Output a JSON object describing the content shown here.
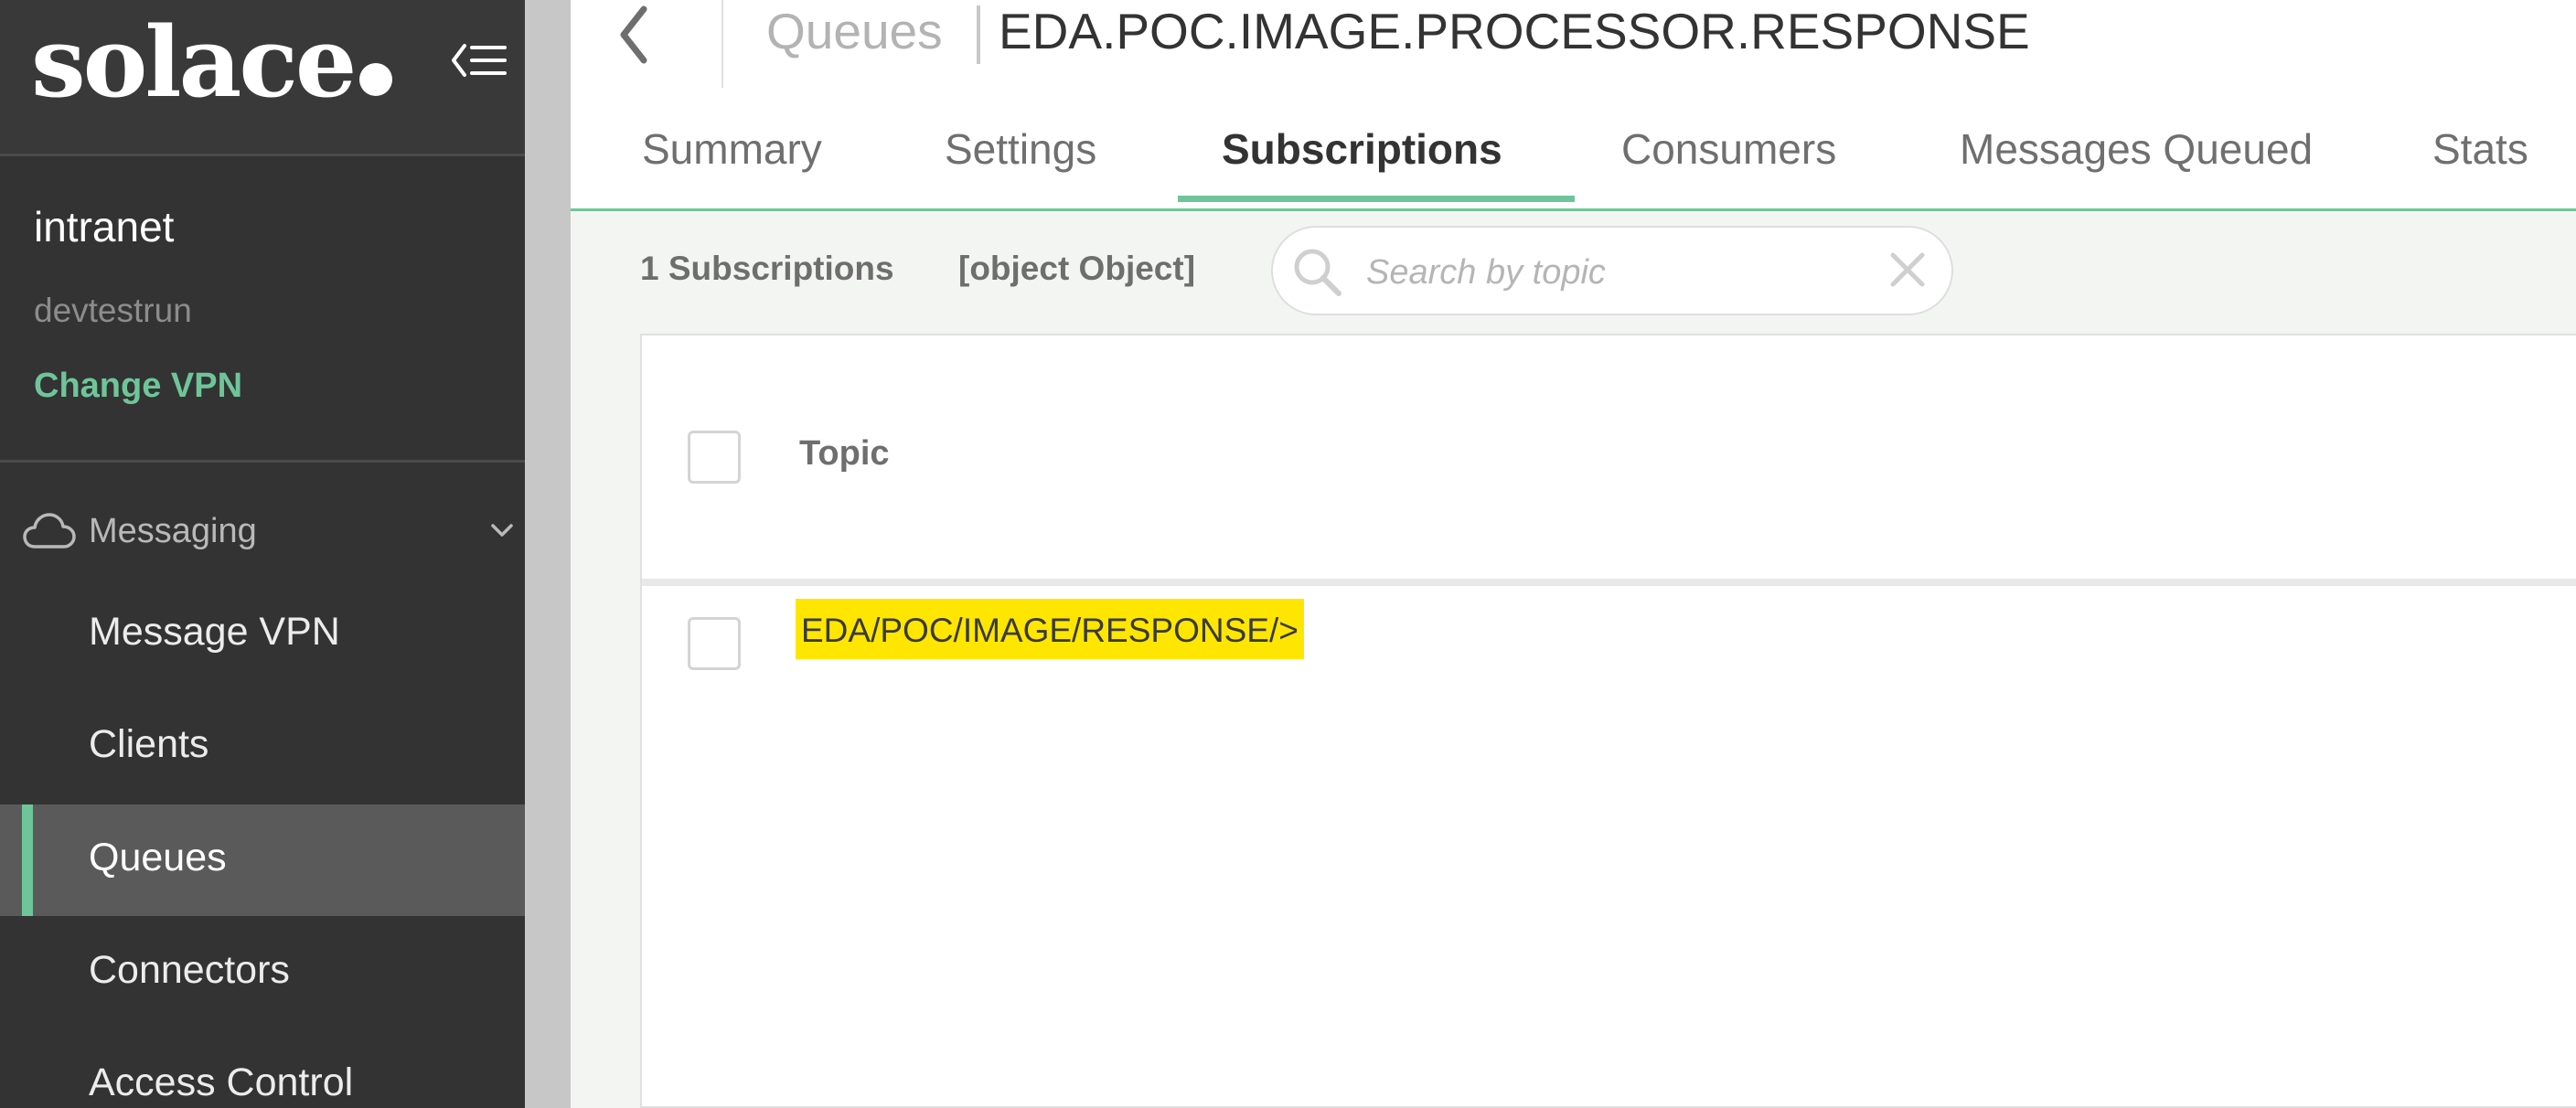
{
  "brand": {
    "logo_text": "solace"
  },
  "sidebar": {
    "vpn_name": "intranet",
    "vpn_sub": "devtestrun",
    "change_vpn_label": "Change VPN",
    "section_label": "Messaging",
    "items": [
      {
        "label": "Message VPN",
        "active": false
      },
      {
        "label": "Clients",
        "active": false
      },
      {
        "label": "Queues",
        "active": true
      },
      {
        "label": "Connectors",
        "active": false
      },
      {
        "label": "Access Control",
        "active": false
      }
    ]
  },
  "header": {
    "breadcrumb": "Queues",
    "title": "EDA.POC.IMAGE.PROCESSOR.RESPONSE"
  },
  "tabs": [
    {
      "label": "Summary",
      "active": false
    },
    {
      "label": "Settings",
      "active": false
    },
    {
      "label": "Subscriptions",
      "active": true
    },
    {
      "label": "Consumers",
      "active": false
    },
    {
      "label": "Messages Queued",
      "active": false
    },
    {
      "label": "Stats",
      "active": false
    }
  ],
  "subscriptions": {
    "count_label": "1 Subscriptions",
    "object_label": "[object Object]",
    "search_placeholder": "Search by topic",
    "column_topic": "Topic",
    "rows": [
      {
        "topic": "EDA/POC/IMAGE/RESPONSE/>",
        "highlight_color": "#ffe600"
      }
    ]
  },
  "colors": {
    "accent": "#6fc59a",
    "sidebar_bg": "#333333",
    "active_item_bg": "#5a5a5a",
    "highlight": "#ffe600"
  }
}
